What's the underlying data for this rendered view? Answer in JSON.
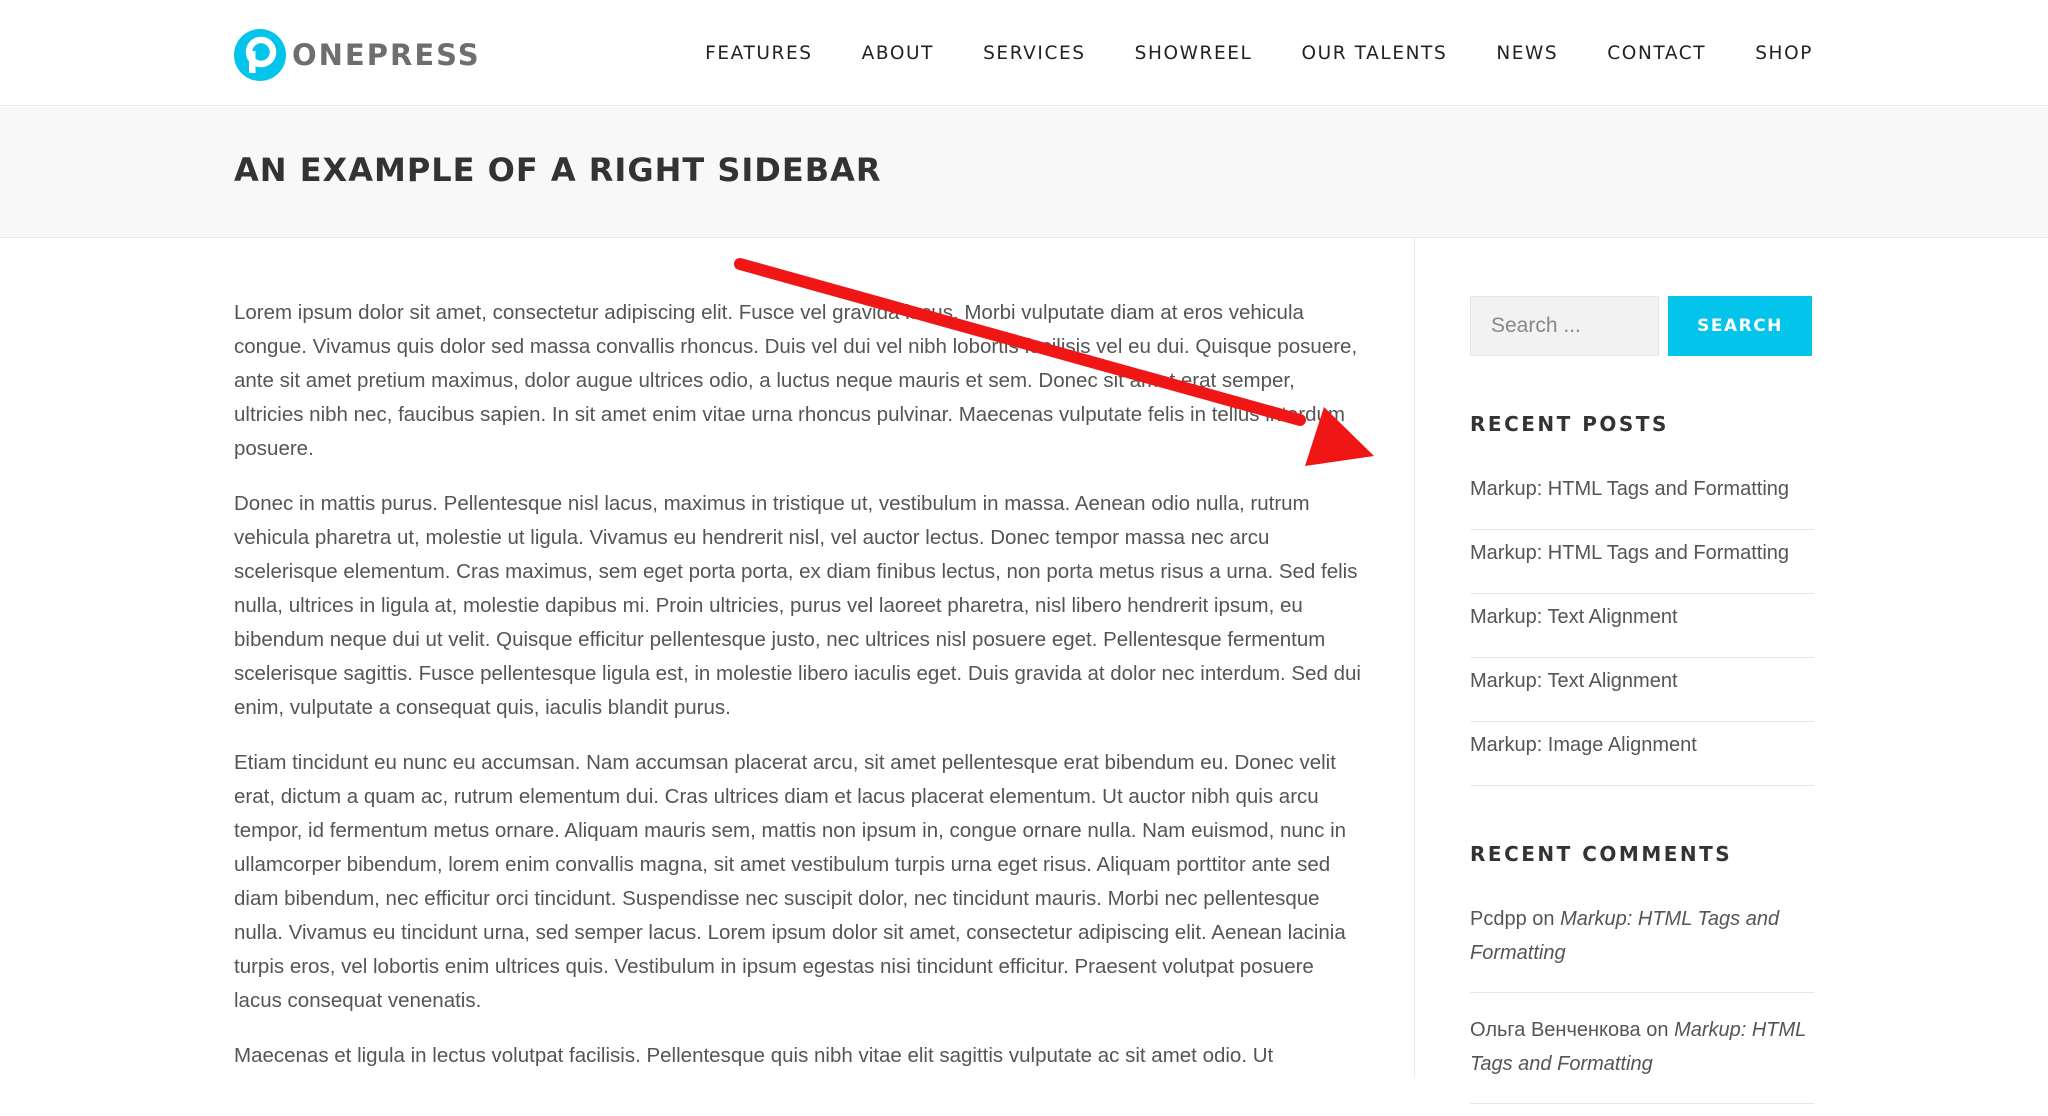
{
  "header": {
    "logo_text": "ONEPRESS",
    "nav": [
      "FEATURES",
      "ABOUT",
      "SERVICES",
      "SHOWREEL",
      "OUR TALENTS",
      "NEWS",
      "CONTACT",
      "SHOP"
    ]
  },
  "page": {
    "title": "AN EXAMPLE OF A RIGHT SIDEBAR"
  },
  "content": {
    "paragraphs": [
      "Lorem ipsum dolor sit amet, consectetur adipiscing elit. Fusce vel gravida lacus. Morbi vulputate diam at eros vehicula congue. Vivamus quis dolor sed massa convallis rhoncus. Duis vel dui vel nibh lobortis facilisis vel eu dui. Quisque posuere, ante sit amet pretium maximus, dolor augue ultrices odio, a luctus neque mauris et sem. Donec sit amet erat semper, ultricies nibh nec, faucibus sapien. In sit amet enim vitae urna rhoncus pulvinar. Maecenas vulputate felis in tellus interdum posuere.",
      "Donec in mattis purus. Pellentesque nisl lacus, maximus in tristique ut, vestibulum in massa. Aenean odio nulla, rutrum vehicula pharetra ut, molestie ut ligula. Vivamus eu hendrerit nisl, vel auctor lectus. Donec tempor massa nec arcu scelerisque elementum. Cras maximus, sem eget porta porta, ex diam finibus lectus, non porta metus risus a urna. Sed felis nulla, ultrices in ligula at, molestie dapibus mi. Proin ultricies, purus vel laoreet pharetra, nisl libero hendrerit ipsum, eu bibendum neque dui ut velit. Quisque efficitur pellentesque justo, nec ultrices nisl posuere eget. Pellentesque fermentum scelerisque sagittis. Fusce pellentesque ligula est, in molestie libero iaculis eget. Duis gravida at dolor nec interdum. Sed dui enim, vulputate a consequat quis, iaculis blandit purus.",
      "Etiam tincidunt eu nunc eu accumsan. Nam accumsan placerat arcu, sit amet pellentesque erat bibendum eu. Donec velit erat, dictum a quam ac, rutrum elementum dui. Cras ultrices diam et lacus placerat elementum. Ut auctor nibh quis arcu tempor, id fermentum metus ornare. Aliquam mauris sem, mattis non ipsum in, congue ornare nulla. Nam euismod, nunc in ullamcorper bibendum, lorem enim convallis magna, sit amet vestibulum turpis urna eget risus. Aliquam porttitor ante sed diam bibendum, nec efficitur orci tincidunt. Suspendisse nec suscipit dolor, nec tincidunt mauris. Morbi nec pellentesque nulla. Vivamus eu tincidunt urna, sed semper lacus. Lorem ipsum dolor sit amet, consectetur adipiscing elit. Aenean lacinia turpis eros, vel lobortis enim ultrices quis. Vestibulum in ipsum egestas nisi tincidunt efficitur. Praesent volutpat posuere lacus consequat venenatis.",
      "Maecenas et ligula in lectus volutpat facilisis. Pellentesque quis nibh vitae elit sagittis vulputate ac sit amet odio. Ut"
    ]
  },
  "sidebar": {
    "search": {
      "placeholder": "Search ...",
      "button_label": "SEARCH"
    },
    "recent_posts": {
      "title": "RECENT POSTS",
      "items": [
        "Markup: HTML Tags and Formatting",
        "Markup: HTML Tags and Formatting",
        "Markup: Text Alignment",
        "Markup: Text Alignment",
        "Markup: Image Alignment"
      ]
    },
    "recent_comments": {
      "title": "RECENT COMMENTS",
      "items": [
        {
          "author": "Pcdpp",
          "on": "on",
          "post": "Markup: HTML Tags and Formatting"
        },
        {
          "author": "Ольга Венченкова",
          "on": "on",
          "post": "Markup: HTML Tags and Formatting"
        }
      ]
    }
  },
  "colors": {
    "accent": "#03c4eb",
    "annotation_arrow": "#f01616"
  },
  "icons": {
    "logo": "onepress-logo-icon"
  }
}
